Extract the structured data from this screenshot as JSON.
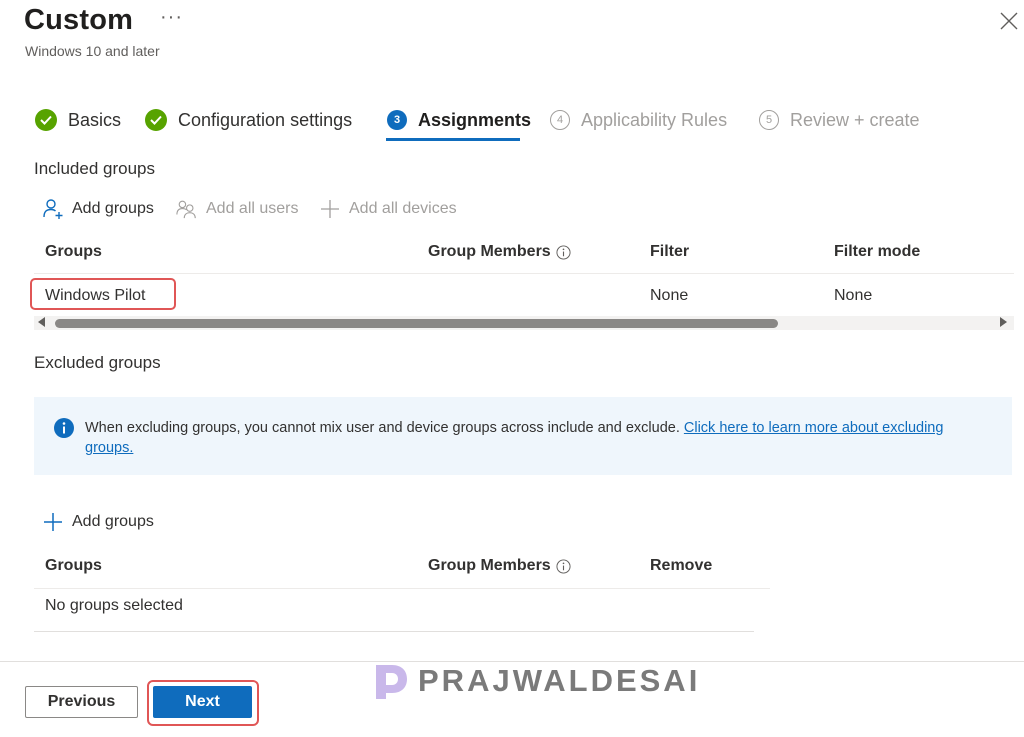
{
  "header": {
    "title": "Custom",
    "more_label": "···",
    "subtitle": "Windows 10 and later"
  },
  "steps": [
    {
      "num": "",
      "label": "Basics",
      "state": "done"
    },
    {
      "num": "",
      "label": "Configuration settings",
      "state": "done"
    },
    {
      "num": "3",
      "label": "Assignments",
      "state": "active"
    },
    {
      "num": "4",
      "label": "Applicability Rules",
      "state": "inactive"
    },
    {
      "num": "5",
      "label": "Review + create",
      "state": "inactive"
    }
  ],
  "included": {
    "heading": "Included groups",
    "commands": {
      "add_groups": "Add groups",
      "add_all_users": "Add all users",
      "add_all_devices": "Add all devices"
    },
    "columns": {
      "groups": "Groups",
      "group_members": "Group Members",
      "filter": "Filter",
      "filter_mode": "Filter mode"
    },
    "rows": [
      {
        "group": "Windows Pilot",
        "members": "",
        "filter": "None",
        "filter_mode": "None"
      }
    ]
  },
  "excluded": {
    "heading": "Excluded groups",
    "message": "When excluding groups, you cannot mix user and device groups across include and exclude.",
    "link_text": "Click here to learn more about excluding groups.",
    "add_groups": "Add groups",
    "columns": {
      "groups": "Groups",
      "group_members": "Group Members",
      "remove": "Remove"
    },
    "empty_text": "No groups selected"
  },
  "footer": {
    "previous_label": "Previous",
    "next_label": "Next"
  },
  "watermark": {
    "text": "PRAJWALDESAI"
  },
  "colors": {
    "accent": "#0f6cbd",
    "success": "#57a300",
    "highlight_box": "#e05656",
    "message_bg": "#eff6fc"
  }
}
